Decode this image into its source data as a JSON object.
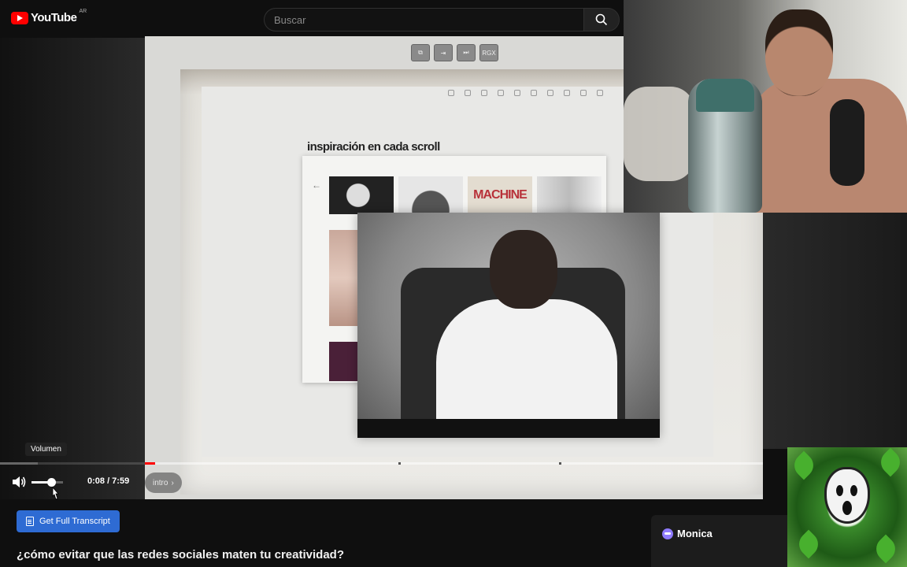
{
  "header": {
    "logo_text": "YouTube",
    "region": "AR",
    "search_placeholder": "Buscar"
  },
  "player": {
    "screen_headline": "inspiración en cada scroll",
    "thumb_text": "MACHINE",
    "chapter_label": "intro",
    "volume_tooltip": "Volumen",
    "time_display": "0:08 / 7:59",
    "progress_fraction": 0.017,
    "volume_fraction": 0.62,
    "ctrl_badge": "RGX"
  },
  "below_player": {
    "transcript_button": "Get Full Transcript",
    "title": "¿cómo evitar que las redes sociales maten tu creatividad?"
  },
  "monica": {
    "label": "Monica"
  },
  "icons": [
    "youtube-logo-icon",
    "search-icon",
    "volume-icon",
    "cursor-icon",
    "document-icon",
    "monica-icon"
  ],
  "colors": {
    "accent_red": "#ff0000",
    "transcript_blue": "#2e6bd3",
    "background": "#0f0f0f"
  }
}
